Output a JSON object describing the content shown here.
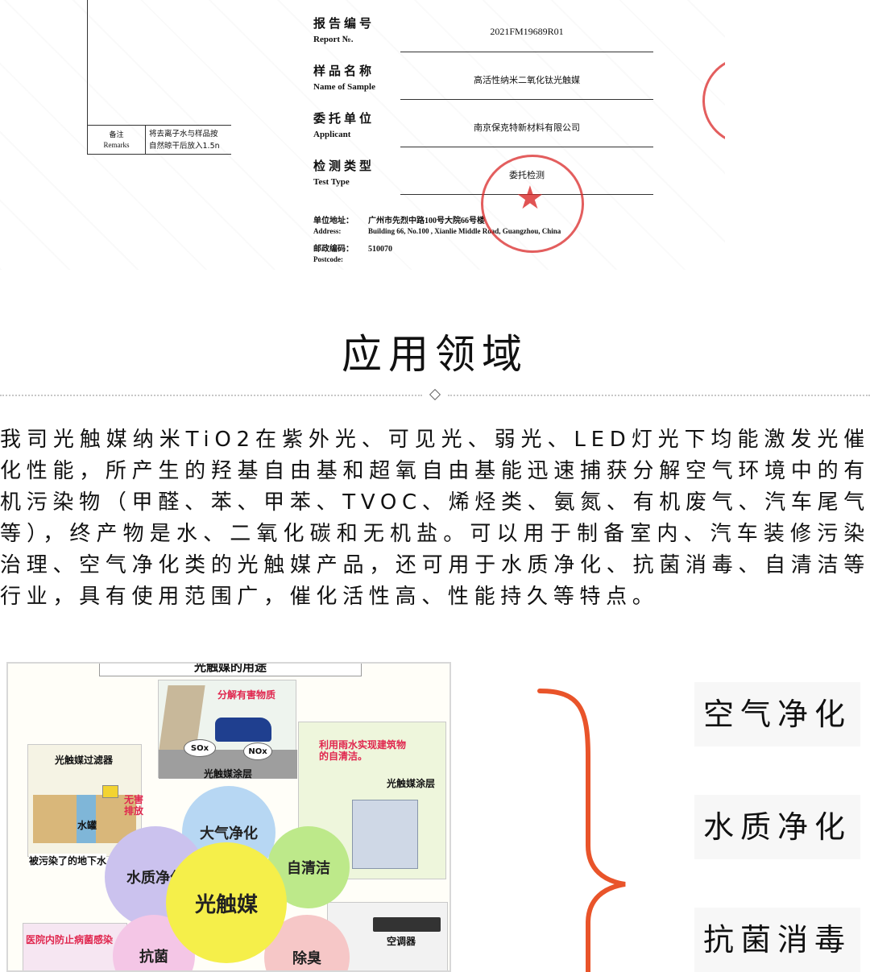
{
  "report": {
    "fields": [
      {
        "zh": "报告编号",
        "en": "Report №.",
        "value": "2021FM19689R01"
      },
      {
        "zh": "样品名称",
        "en": "Name of Sample",
        "value": "高活性纳米二氧化钛光触媒"
      },
      {
        "zh": "委托单位",
        "en": "Applicant",
        "value": "南京保克特新材料有限公司"
      },
      {
        "zh": "检测类型",
        "en": "Test Type",
        "value": "委托检测"
      }
    ],
    "remarks_label_zh": "备注",
    "remarks_label_en": "Remarks",
    "remarks_line1": "将去离子水与样品按",
    "remarks_line2": "自然晾干后放入1.5n",
    "address": {
      "label_zh": "单位地址：",
      "value_zh": "广州市先烈中路100号大院66号楼",
      "label_en": "Address:",
      "value_en": "Building 66, No.100 , Xianlie Middle Road, Guangzhou, China",
      "postcode_label_zh": "邮政编码：",
      "postcode": "510070",
      "postcode_label_en": "Postcode:"
    }
  },
  "section_title": "应用领域",
  "paragraph": "我司光触媒纳米TiO2在紫外光、可见光、弱光、LED灯光下均能激发光催化性能，所产生的羟基自由基和超氧自由基能迅速捕获分解空气环境中的有机污染物（甲醛、苯、甲苯、TVOC、烯烃类、氨氮、有机废气、汽车尾气等），终产物是水、二氧化碳和无机盐。可以用于制备室内、汽车装修污染治理、空气净化类的光触媒产品，还可用于水质净化、抗菌消毒、自清洁等行业，具有使用范围广，催化活性高、性能持久等特点。",
  "diagram": {
    "title": "光触媒的用途",
    "decompose": "分解有害物质",
    "sox": "SOx",
    "nox": "NOx",
    "coating_top": "光触媒涂层",
    "filter": "光触媒过滤器",
    "harmless": "无害",
    "discharge": "排放",
    "tank": "水罐",
    "groundwater": "被污染了的地下水",
    "rain_line1": "利用雨水实现建筑物",
    "rain_line2": "的自清洁。",
    "coating_right": "光触媒涂层",
    "hospital": "医院内防止病菌感染",
    "aircon": "空调器",
    "bubbles": {
      "air": "大气净化",
      "water": "水质净化",
      "self": "自清洁",
      "center": "光触媒",
      "anti": "抗菌",
      "deodor": "除臭"
    }
  },
  "tags": [
    "空气净化",
    "水质净化",
    "抗菌消毒"
  ],
  "colors": {
    "brace": "#e9542a",
    "seal": "#da2828",
    "bubble_yellow": "#f5ef4a",
    "bubble_purple": "#cbc2ee",
    "bubble_green": "#bde98a",
    "bubble_pink": "#f4c6e6",
    "bubble_blue": "#b7d7f3"
  }
}
